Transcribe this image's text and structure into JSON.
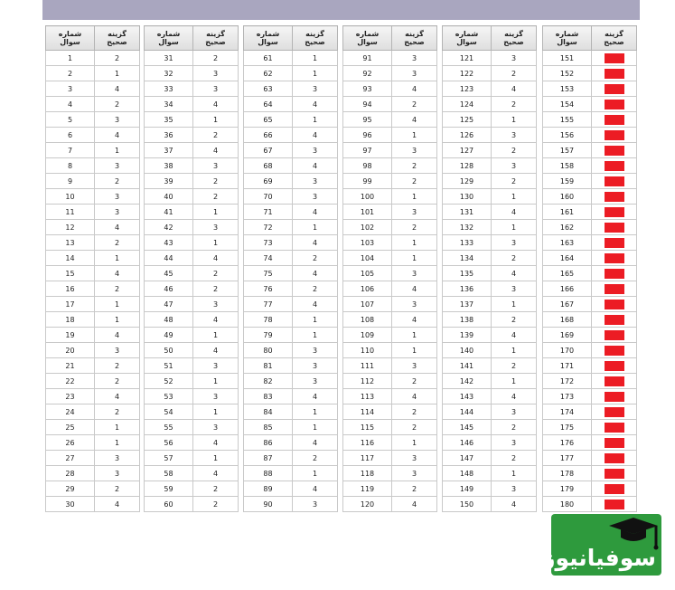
{
  "header": {
    "answer_label": "گزینه\nصحیح",
    "question_label": "شماره\nسوال"
  },
  "groups": [
    {
      "answers": [
        2,
        1,
        4,
        2,
        3,
        4,
        1,
        3,
        2,
        3,
        3,
        4,
        2,
        1,
        4,
        2,
        1,
        1,
        4,
        3,
        2,
        2,
        4,
        2,
        1,
        1,
        3,
        3,
        2,
        4
      ]
    },
    {
      "answers": [
        2,
        3,
        3,
        4,
        1,
        2,
        4,
        3,
        2,
        2,
        1,
        3,
        1,
        4,
        2,
        2,
        3,
        4,
        1,
        4,
        3,
        1,
        3,
        1,
        3,
        4,
        1,
        4,
        2,
        2
      ]
    },
    {
      "answers": [
        1,
        1,
        3,
        4,
        1,
        4,
        3,
        4,
        3,
        3,
        4,
        1,
        4,
        2,
        4,
        2,
        4,
        1,
        1,
        3,
        3,
        3,
        4,
        1,
        1,
        4,
        2,
        1,
        4,
        3
      ]
    },
    {
      "answers": [
        3,
        3,
        4,
        2,
        4,
        1,
        3,
        2,
        2,
        1,
        3,
        2,
        1,
        1,
        3,
        4,
        3,
        4,
        1,
        1,
        3,
        2,
        4,
        2,
        2,
        1,
        3,
        3,
        2,
        4
      ]
    },
    {
      "answers": [
        3,
        2,
        4,
        2,
        1,
        3,
        2,
        3,
        2,
        1,
        4,
        1,
        3,
        2,
        4,
        3,
        1,
        2,
        4,
        1,
        2,
        1,
        4,
        3,
        2,
        3,
        2,
        1,
        3,
        4
      ]
    },
    {
      "answers": [
        "",
        "",
        "",
        "",
        "",
        "",
        "",
        "",
        "",
        "",
        "",
        "",
        "",
        "",
        "",
        "",
        "",
        "",
        "",
        "",
        "",
        "",
        "",
        "",
        "",
        "",
        "",
        "",
        "",
        ""
      ],
      "redacted": true
    }
  ],
  "colors": {
    "header_bar": "#a9a6bf",
    "redacted_cell": "#ec1c24",
    "logo_background": "#2e9a3d"
  },
  "logo": {
    "text": "سوفیانیوز",
    "icon": "graduation-cap-icon"
  }
}
